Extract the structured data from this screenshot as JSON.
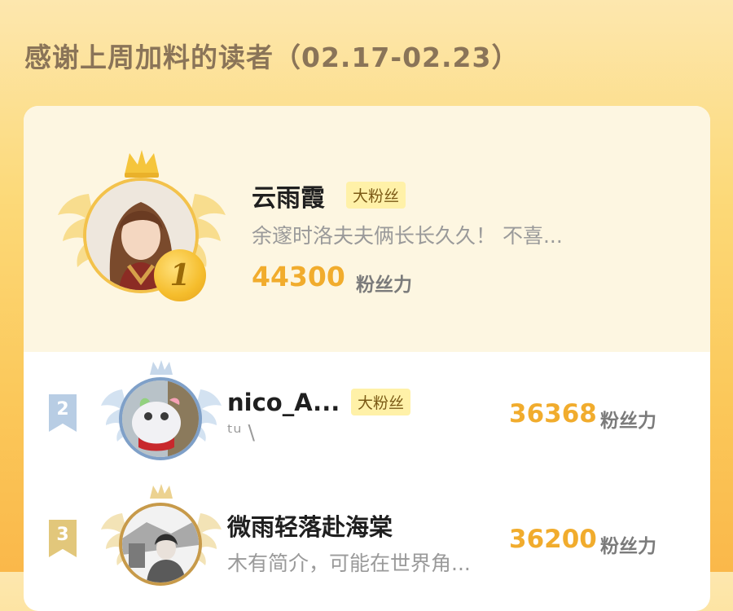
{
  "header": {
    "title": "感谢上周加料的读者（02.17-02.23）"
  },
  "leaderboard": [
    {
      "rank": "1",
      "name": "云雨霞",
      "tag": "大粉丝",
      "desc": "余邃时洛夫夫俩长长久久！ 不喜...",
      "score": "44300",
      "unit": "粉丝力"
    },
    {
      "rank": "2",
      "name": "nico_A...",
      "tag": "大粉丝",
      "desc": "ᵗᵘ   \\",
      "score": "36368",
      "unit": "粉丝力"
    },
    {
      "rank": "3",
      "name": "微雨轻落赴海棠",
      "desc": "木有简介，可能在世界角...",
      "score": "36200",
      "unit": "粉丝力"
    }
  ],
  "colors": {
    "accent": "#f1ac2d",
    "gold": "#f3c24b",
    "silver": "#b8cde4",
    "bronze": "#e2c77b"
  },
  "icons": {
    "rank1_badge": "crown-wings-icon",
    "rank2_badge": "silver-crown-wings-icon",
    "rank3_badge": "bronze-crown-wings-icon"
  }
}
